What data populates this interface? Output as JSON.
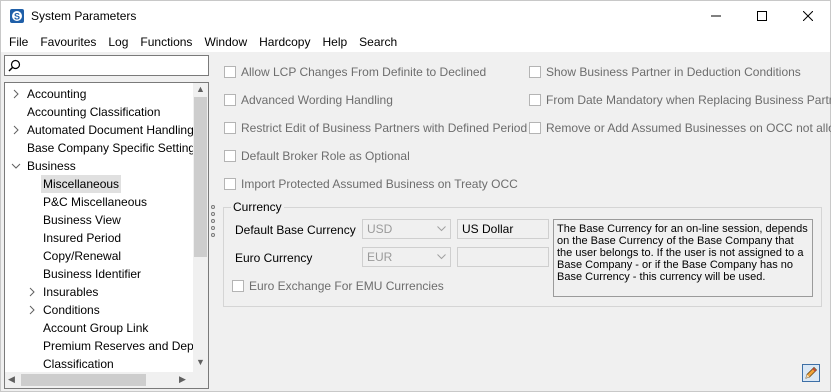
{
  "window": {
    "title": "System Parameters"
  },
  "menu": [
    "File",
    "Favourites",
    "Log",
    "Functions",
    "Window",
    "Hardcopy",
    "Help",
    "Search"
  ],
  "search": {
    "value": "",
    "placeholder": ""
  },
  "tree": [
    {
      "label": "Accounting",
      "expander": "collapsed",
      "level": 0
    },
    {
      "label": "Accounting Classification",
      "expander": "none",
      "level": 0
    },
    {
      "label": "Automated Document Handling",
      "expander": "collapsed",
      "level": 0
    },
    {
      "label": "Base Company Specific Settings",
      "expander": "none",
      "level": 0
    },
    {
      "label": "Business",
      "expander": "expanded",
      "level": 0
    },
    {
      "label": "Miscellaneous",
      "expander": "none",
      "level": 1,
      "selected": true
    },
    {
      "label": "P&C Miscellaneous",
      "expander": "none",
      "level": 1
    },
    {
      "label": "Business View",
      "expander": "none",
      "level": 1
    },
    {
      "label": "Insured Period",
      "expander": "none",
      "level": 1
    },
    {
      "label": "Copy/Renewal",
      "expander": "none",
      "level": 1
    },
    {
      "label": "Business Identifier",
      "expander": "none",
      "level": 1
    },
    {
      "label": "Insurables",
      "expander": "collapsed",
      "level": 1
    },
    {
      "label": "Conditions",
      "expander": "collapsed",
      "level": 1
    },
    {
      "label": "Account Group Link",
      "expander": "none",
      "level": 1
    },
    {
      "label": "Premium Reserves and Deposit",
      "expander": "none",
      "level": 1
    },
    {
      "label": "Classification",
      "expander": "none",
      "level": 1
    }
  ],
  "checkboxes_left": [
    {
      "label": "Allow LCP Changes From Definite to Declined",
      "checked": false
    },
    {
      "label": "Advanced Wording Handling",
      "checked": false
    },
    {
      "label": "Restrict Edit of Business Partners with Defined Period",
      "checked": false
    },
    {
      "label": "Default Broker Role as Optional",
      "checked": false
    },
    {
      "label": "Import Protected Assumed Business on Treaty OCC",
      "checked": false
    }
  ],
  "checkboxes_right": [
    {
      "label": "Show Business Partner in Deduction Conditions",
      "checked": false
    },
    {
      "label": "From Date Mandatory when Replacing Business Partner",
      "checked": false
    },
    {
      "label": "Remove or Add Assumed Businesses on OCC not allowed",
      "checked": false
    }
  ],
  "currency": {
    "group_title": "Currency",
    "base_label": "Default Base Currency",
    "base_value": "USD",
    "base_name": "US Dollar",
    "euro_label": "Euro Currency",
    "euro_value": "EUR",
    "euro_name": "",
    "emu_label": "Euro Exchange For EMU Currencies",
    "emu_checked": false,
    "info": "The Base Currency for an on-line session, depends on the Base Currency of the Base Company that the user belongs to.  If the user is not assigned to a Base Company - or if the Base Company has no Base Currency - this currency will be used."
  },
  "colors": {
    "disabled_text": "#6d6d6d",
    "selection": "#e0e0e0"
  }
}
